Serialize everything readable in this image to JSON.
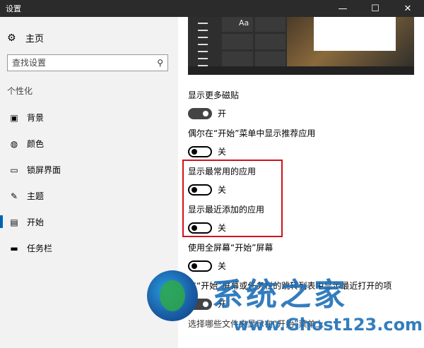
{
  "window": {
    "title": "设置",
    "minimize": "—",
    "maximize": "☐",
    "close": "✕"
  },
  "sidebar": {
    "home": "主页",
    "search_placeholder": "查找设置",
    "section": "个性化",
    "items": [
      {
        "label": "背景",
        "icon": "picture-icon",
        "active": false
      },
      {
        "label": "颜色",
        "icon": "palette-icon",
        "active": false
      },
      {
        "label": "锁屏界面",
        "icon": "lock-screen-icon",
        "active": false
      },
      {
        "label": "主题",
        "icon": "theme-icon",
        "active": false
      },
      {
        "label": "开始",
        "icon": "start-icon",
        "active": true
      },
      {
        "label": "任务栏",
        "icon": "taskbar-icon",
        "active": false
      }
    ]
  },
  "preview": {
    "sample_text": "Aa"
  },
  "settings": [
    {
      "label": "显示更多磁贴",
      "state": "开",
      "on": true
    },
    {
      "label": "偶尔在“开始”菜单中显示推荐应用",
      "state": "关",
      "on": false
    },
    {
      "label": "显示最常用的应用",
      "state": "关",
      "on": false
    },
    {
      "label": "显示最近添加的应用",
      "state": "关",
      "on": false
    },
    {
      "label": "使用全屏幕“开始”屏幕",
      "state": "关",
      "on": false
    },
    {
      "label": "在“开始”屏幕或任务栏的跳转列表中显示最近打开的项",
      "state": "开",
      "on": true
    },
    {
      "label": "选择哪些文件夹显示在“开始”菜单上"
    }
  ],
  "watermark": {
    "brand": "系统之家",
    "url": "www.Ghost123.com"
  }
}
